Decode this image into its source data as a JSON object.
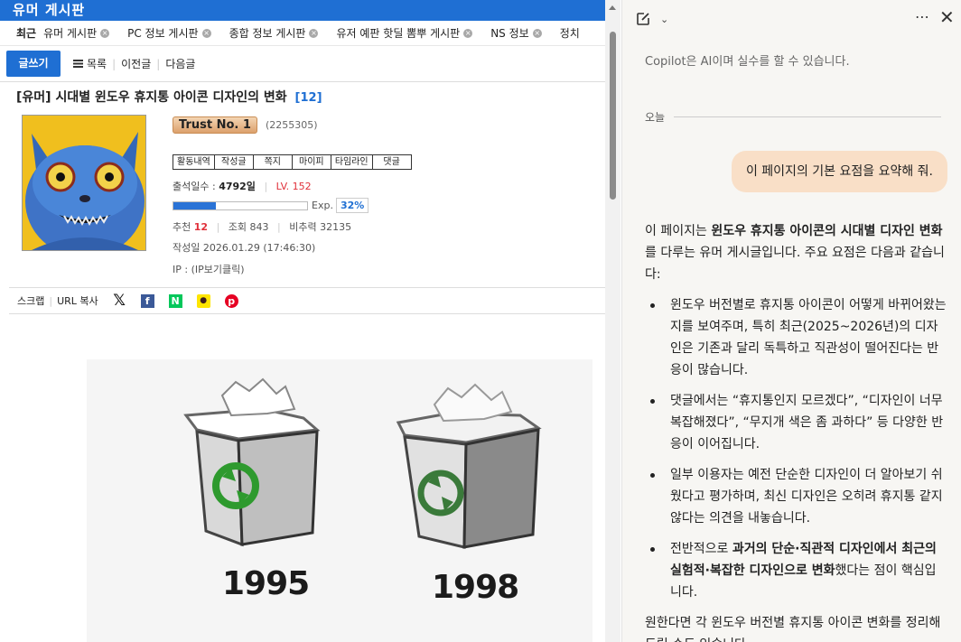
{
  "board": {
    "title": "유머 게시판",
    "recent_label": "최근",
    "recent_tabs": [
      "유머 게시판",
      "PC 정보 게시판",
      "종합 정보 게시판",
      "유저 예판 핫딜 뽐뿌 게시판",
      "NS 정보",
      "정치"
    ],
    "write_button": "글쓰기",
    "list_button": "목록",
    "prev_button": "이전글",
    "next_button": "다음글",
    "post": {
      "category": "[유머]",
      "title": "시대별 윈도우 휴지통 아이콘 디자인의 변화",
      "comment_count": "[12]"
    },
    "author": {
      "nickname": "Trust No. 1",
      "user_id": "(2255305)",
      "tabs": [
        "활동내역",
        "작성글",
        "쪽지",
        "마이피",
        "타임라인",
        "댓글"
      ],
      "attendance_label": "출석일수 :",
      "attendance_value": "4792일",
      "level": "LV. 152",
      "exp_label": "Exp.",
      "exp_percent": "32%",
      "exp_fraction": 0.32,
      "recommend_label": "추천",
      "recommend_value": "12",
      "views_label": "조회",
      "views_value": "843",
      "nonrec_label": "비추력",
      "nonrec_value": "32135",
      "date_label": "작성일",
      "date_value": "2026.01.29 (17:46:30)",
      "ip_label": "IP :",
      "ip_value": "(IP보기클릭)"
    },
    "share": {
      "scrap": "스크랩",
      "url_copy": "URL 복사"
    },
    "image": {
      "year_1": "1995",
      "year_2": "1998"
    }
  },
  "copilot": {
    "notice": "Copilot은 AI이며 실수를 할 수 있습니다.",
    "today_label": "오늘",
    "user_message": "이 페이지의 기본 요점을 요약해 줘.",
    "intro_a": "이 페이지는 ",
    "intro_b": "윈도우 휴지통 아이콘의 시대별 디자인 변화",
    "intro_c": "를 다루는 유머 게시글입니다. 주요 요점은 다음과 같습니다:",
    "bullet_1": "윈도우 버전별로 휴지통 아이콘이 어떻게 바뀌어왔는지를 보여주며, 특히 최근(2025~2026년)의 디자인은 기존과 달리 독특하고 직관성이 떨어진다는 반응이 많습니다.",
    "bullet_2": "댓글에서는 “휴지통인지 모르겠다”, “디자인이 너무 복잡해졌다”, “무지개 색은 좀 과하다” 등 다양한 반응이 이어집니다.",
    "bullet_3": "일부 이용자는 예전 단순한 디자인이 더 알아보기 쉬웠다고 평가하며, 최신 디자인은 오히려 휴지통 같지 않다는 의견을 내놓습니다.",
    "bullet_4_a": "전반적으로 ",
    "bullet_4_b": "과거의 단순·직관적 디자인에서 최근의 실험적·복잡한 디자인으로 변화",
    "bullet_4_c": "했다는 점이 핵심입니다.",
    "closing": "원한다면 각 윈도우 버전별 휴지통 아이콘 변화를 정리해 드릴 수도 있습니다."
  },
  "colors": {
    "brand_blue": "#1f6fd3",
    "level_red": "#e0303a",
    "user_bubble": "#f9dfc7"
  }
}
